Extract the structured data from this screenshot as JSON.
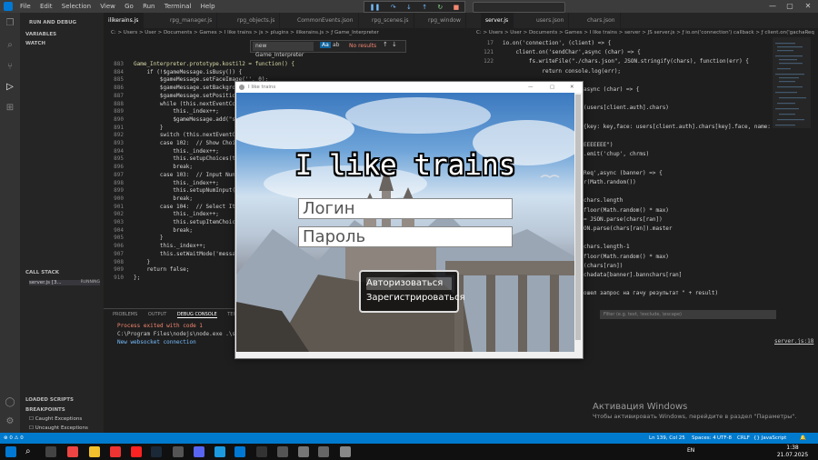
{
  "titlebar": {
    "menus": [
      "File",
      "Edit",
      "Selection",
      "View",
      "Go",
      "Run",
      "Terminal",
      "Help"
    ],
    "controls": [
      "—",
      "▢",
      "✕"
    ]
  },
  "sidebar": {
    "header": "RUN AND DEBUG",
    "variables": "VARIABLES",
    "watch": "WATCH",
    "call_stack": "CALL STACK",
    "call_stack_item": "server.js [3...",
    "call_stack_status": "RUNNING",
    "loaded_scripts": "LOADED SCRIPTS",
    "breakpoints": "BREAKPOINTS",
    "bp_caught": "Caught Exceptions",
    "bp_uncaught": "Uncaught Exceptions"
  },
  "editor_left": {
    "tabs": [
      "ilikerains.js",
      "rpg_manager.js",
      "rpg_objects.js",
      "CommonEvents.json",
      "rpg_scenes.js",
      "rpg_window"
    ],
    "breadcrumb": "C: > Users > User > Documents > Games > I like trains > js > plugins > ilikerains.js > ƒ Game_Interpreter",
    "find": {
      "value": "new Game_Interpreter",
      "result": "No results"
    },
    "lines": [
      {
        "n": "883",
        "t": "Game_Interpreter.prototype.kostil2 = function() {"
      },
      {
        "n": "884",
        "t": "    if (!$gameMessage.isBusy()) {"
      },
      {
        "n": "885",
        "t": "        $gameMessage.setFaceImage('', 0);"
      },
      {
        "n": "886",
        "t": "        $gameMessage.setBackground(0);"
      },
      {
        "n": "887",
        "t": "        $gameMessage.setPositionType(2);"
      },
      {
        "n": "888",
        "t": "        while (this.nextEventCode() === 401) {"
      },
      {
        "n": "889",
        "t": "            this._index++;"
      },
      {
        "n": "890",
        "t": "            $gameMessage.add(\"s\");"
      },
      {
        "n": "891",
        "t": "        }"
      },
      {
        "n": "892",
        "t": "        switch (this.nextEventCode()) {"
      },
      {
        "n": "893",
        "t": "        case 102:  // Show Choices"
      },
      {
        "n": "894",
        "t": "            this._index++;"
      },
      {
        "n": "895",
        "t": "            this.setupChoices(this.currentCommand().parameters);"
      },
      {
        "n": "896",
        "t": "            break;"
      },
      {
        "n": "897",
        "t": "        case 103:  // Input Number"
      },
      {
        "n": "898",
        "t": "            this._index++;"
      },
      {
        "n": "899",
        "t": "            this.setupNumInput(this.currentCommand().parameters);"
      },
      {
        "n": "900",
        "t": "            break;"
      },
      {
        "n": "901",
        "t": "        case 104:  // Select Item"
      },
      {
        "n": "902",
        "t": "            this._index++;"
      },
      {
        "n": "903",
        "t": "            this.setupItemChoice(this.currentCommand().parameters);"
      },
      {
        "n": "904",
        "t": "            break;"
      },
      {
        "n": "905",
        "t": "        }"
      },
      {
        "n": "906",
        "t": "        this._index++;"
      },
      {
        "n": "907",
        "t": "        this.setWaitMode('message');"
      },
      {
        "n": "908",
        "t": "    }"
      },
      {
        "n": "909",
        "t": "    return false;"
      },
      {
        "n": "910",
        "t": "};"
      }
    ]
  },
  "panel": {
    "tabs": [
      "PROBLEMS",
      "OUTPUT",
      "DEBUG CONSOLE",
      "TERMINAL"
    ],
    "lines": [
      "Process exited with code 1",
      "C:\\Program Files\\nodejs\\node.exe .\\server.js",
      "New websocket connection"
    ],
    "right_link": "server.js:18",
    "filter_placeholder": "Filter (e.g. text, !exclude, \\escape)"
  },
  "editor_right": {
    "tabs": [
      "server.js",
      "users.json",
      "chars.json"
    ],
    "breadcrumb": "C: > Users > User > Documents > Games > I like trains > server > JS server.js > ƒ io.on('connection') callback > ƒ client.on('gachaReq",
    "lines": [
      {
        "n": "17",
        "t": "io.on('connection', (client) => {"
      },
      {
        "n": "121",
        "t": "    client.on('sendChar',async (char) => {"
      },
      {
        "n": "122",
        "t": "        fs.writeFile(\"./chars.json\", JSON.stringify(chars), function(err) {"
      },
      {
        "n": "",
        "t": "            return console.log(err);"
      },
      {
        "n": "",
        "t": ""
      },
      {
        "n": "",
        "t": "async (char) => {"
      },
      {
        "n": "",
        "t": ""
      },
      {
        "n": "",
        "t": "(users[client.auth].chars)"
      },
      {
        "n": "",
        "t": ""
      },
      {
        "n": "",
        "t": "{key: key,face: users[client.auth].chars[key].face, name: u"
      },
      {
        "n": "",
        "t": ""
      },
      {
        "n": "",
        "t": "EEEEEEE\")"
      },
      {
        "n": "",
        "t": ".emit('chup', chrms)"
      },
      {
        "n": "",
        "t": ""
      },
      {
        "n": "",
        "t": "Req',async (banner) => {"
      },
      {
        "n": "",
        "t": "r(Math.random())"
      },
      {
        "n": "",
        "t": ""
      },
      {
        "n": "",
        "t": "chars.length"
      },
      {
        "n": "",
        "t": "floor(Math.random() * max)"
      },
      {
        "n": "",
        "t": "= JSON.parse(chars[ran])"
      },
      {
        "n": "",
        "t": "ON.parse(chars[ran]).master"
      },
      {
        "n": "",
        "t": ""
      },
      {
        "n": "",
        "t": "chars.length-1"
      },
      {
        "n": "",
        "t": "floor(Math.random() * max)"
      },
      {
        "n": "",
        "t": "(chars[ran])"
      },
      {
        "n": "",
        "t": "chadata[banner].bannchars[ran]"
      },
      {
        "n": "",
        "t": ""
      },
      {
        "n": "",
        "t": "ошел запрос на гачу результат \" + result)"
      }
    ]
  },
  "statusbar": {
    "position": "Ln 139, Col 25",
    "spaces": "Spaces: 4",
    "encoding": "UTF-8",
    "eol": "CRLF",
    "language": "{} JavaScript"
  },
  "taskbar": {
    "lang": "EN",
    "time": "1:38",
    "date": "21.07.2025"
  },
  "activation": {
    "title": "Активация Windows",
    "subtitle": "Чтобы активировать Windows, перейдите в раздел \"Параметры\"."
  },
  "game": {
    "window_title": "I like trains",
    "title": "I like trains",
    "login_placeholder": "Логин",
    "password_placeholder": "Пароль",
    "menu": [
      "Авторизоваться",
      "Зарегистрироваться"
    ],
    "selected_index": 0
  },
  "colors": {
    "accent": "#007acc",
    "editor_bg": "#1e1e1e",
    "keyword": "#c586c0",
    "error_text": "#f48771"
  }
}
